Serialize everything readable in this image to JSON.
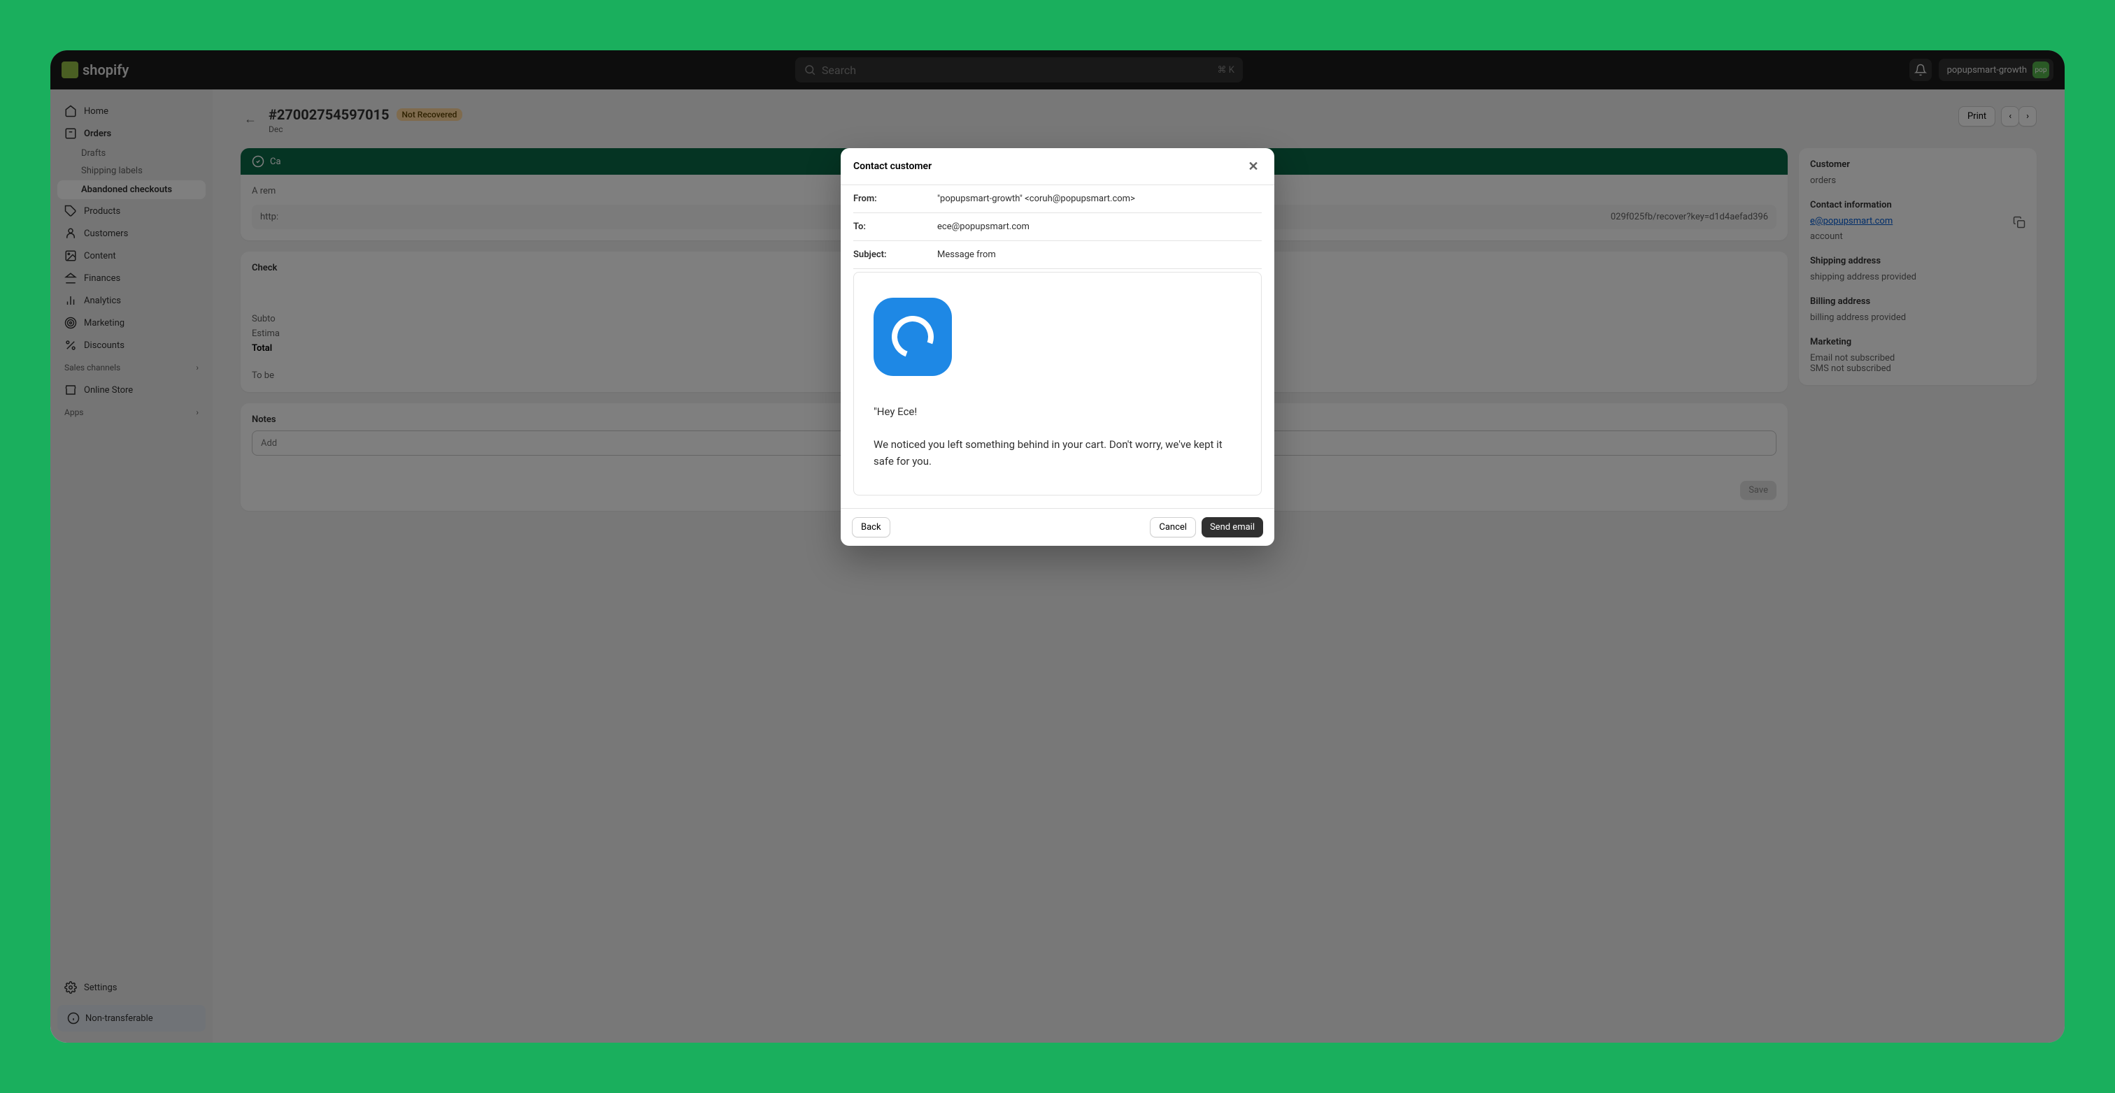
{
  "topbar": {
    "brand": "shopify",
    "search_placeholder": "Search",
    "search_kbd": "⌘ K",
    "store_name": "popupsmart-growth",
    "avatar_text": "pop"
  },
  "sidebar": {
    "home": "Home",
    "orders": "Orders",
    "drafts": "Drafts",
    "shipping_labels": "Shipping labels",
    "abandoned": "Abandoned checkouts",
    "products": "Products",
    "customers": "Customers",
    "content": "Content",
    "finances": "Finances",
    "analytics": "Analytics",
    "marketing": "Marketing",
    "discounts": "Discounts",
    "sales_channels": "Sales channels",
    "online_store": "Online Store",
    "apps": "Apps",
    "settings": "Settings",
    "non_transferable": "Non-transferable"
  },
  "page": {
    "title": "#27002754597015",
    "badge": "Not Recovered",
    "date": "Dec",
    "print": "Print"
  },
  "recovery": {
    "banner": "Ca",
    "reminder": "A rem",
    "url": "http:",
    "url_tail": "029f025fb/recover?key=d1d4aefad396"
  },
  "checkout": {
    "heading": "Check",
    "subtotal": "Subto",
    "estimated": "Estima",
    "total": "Total",
    "tobe": "To be"
  },
  "notes": {
    "heading": "Notes",
    "placeholder": "Add",
    "save": "Save"
  },
  "customer_panel": {
    "heading": "Customer",
    "orders": "orders",
    "contact_heading": "Contact information",
    "email": "e@popupsmart.com",
    "account": "account",
    "shipping_heading": "Shipping address",
    "shipping_value": "shipping address provided",
    "billing_heading": "Billing address",
    "billing_value": "billing address provided",
    "marketing_heading": "Marketing",
    "email_sub": "Email not subscribed",
    "sms_sub": "SMS not subscribed"
  },
  "modal": {
    "title": "Contact customer",
    "from_label": "From:",
    "from_value": "\"popupsmart-growth\" <coruh@popupsmart.com>",
    "to_label": "To:",
    "to_value": "ece@popupsmart.com",
    "subject_label": "Subject:",
    "subject_value": "Message from",
    "greeting": "\"Hey Ece!",
    "body": "We noticed you left something behind in your cart. Don't worry, we've kept it safe for you.",
    "back": "Back",
    "cancel": "Cancel",
    "send": "Send email"
  }
}
